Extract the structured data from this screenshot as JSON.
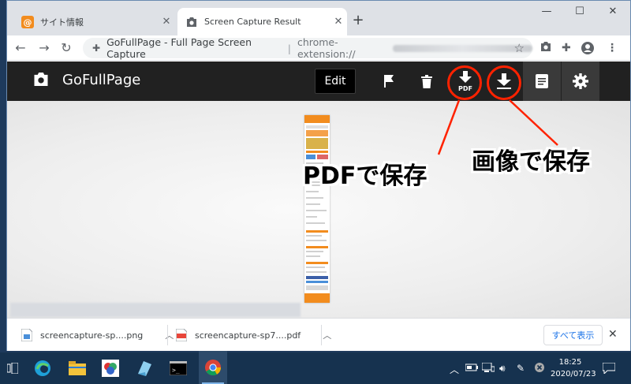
{
  "browser": {
    "tabs": [
      {
        "title": "サイト情報",
        "icon": "at-sign-icon"
      },
      {
        "title": "Screen Capture Result",
        "icon": "camera-icon"
      }
    ],
    "omnibox": {
      "page_title": "GoFullPage - Full Page Screen Capture",
      "url_prefix": "chrome-extension://"
    }
  },
  "app": {
    "title": "GoFullPage",
    "edit_label": "Edit",
    "pdf_icon_label": "PDF"
  },
  "annotations": {
    "pdf_save": "PDFで保存",
    "image_save": "画像で保存",
    "accent_color": "#ff2200"
  },
  "downloads": {
    "items": [
      {
        "name": "screencapture-sp....png"
      },
      {
        "name": "screencapture-sp7....pdf"
      }
    ],
    "show_all": "すべて表示"
  },
  "taskbar": {
    "time": "18:25",
    "date": "2020/07/23"
  }
}
